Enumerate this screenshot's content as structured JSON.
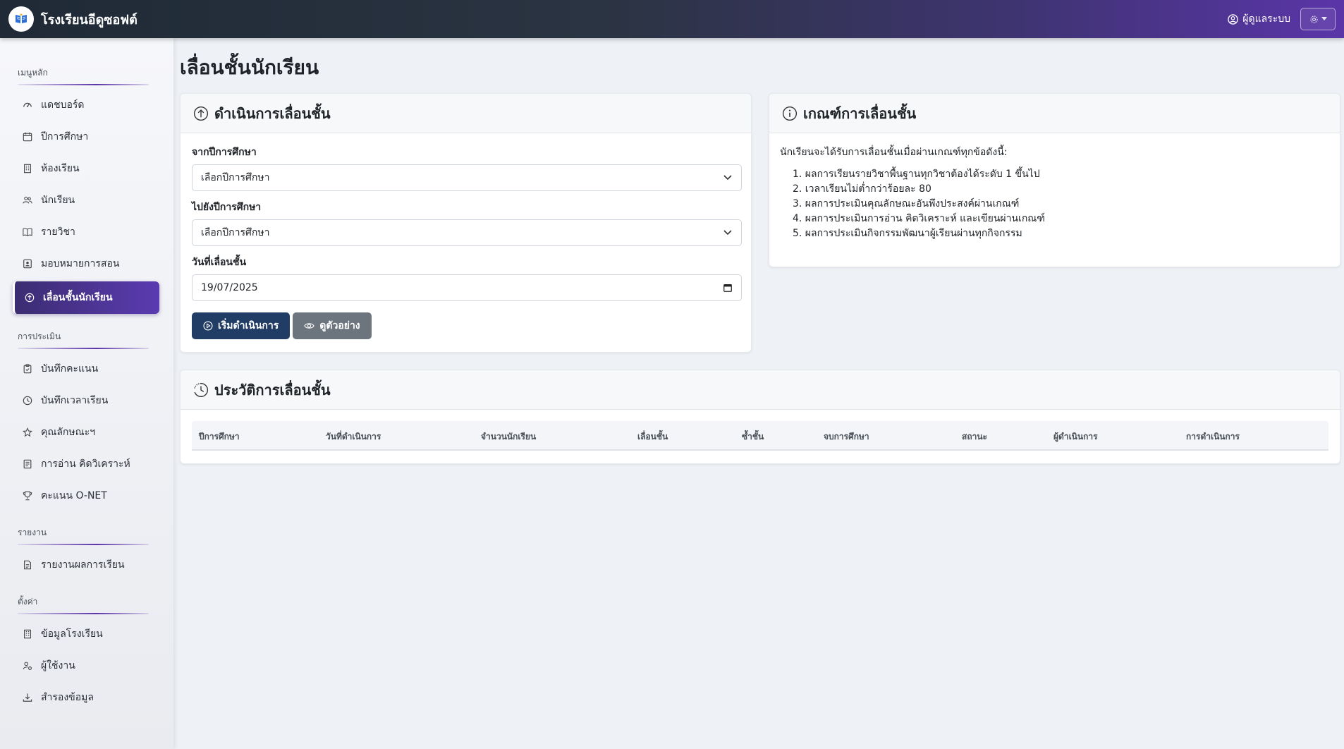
{
  "app": {
    "brand_title": "โรงเรียนอีดูซอฟต์",
    "user_label": "ผู้ดูแลระบบ"
  },
  "sidebar": {
    "sections": [
      {
        "label": "เมนูหลัก",
        "items": [
          {
            "label": "แดชบอร์ด",
            "icon": "speedometer-icon"
          },
          {
            "label": "ปีการศึกษา",
            "icon": "calendar-icon"
          },
          {
            "label": "ห้องเรียน",
            "icon": "building-icon"
          },
          {
            "label": "นักเรียน",
            "icon": "people-icon"
          },
          {
            "label": "รายวิชา",
            "icon": "book-icon"
          },
          {
            "label": "มอบหมายการสอน",
            "icon": "person-badge-icon"
          },
          {
            "label": "เลื่อนชั้นนักเรียน",
            "icon": "arrow-up-circle-icon",
            "active": true
          }
        ]
      },
      {
        "label": "การประเมิน",
        "items": [
          {
            "label": "บันทึกคะแนน",
            "icon": "clipboard-icon"
          },
          {
            "label": "บันทึกเวลาเรียน",
            "icon": "clock-icon"
          },
          {
            "label": "คุณลักษณะฯ",
            "icon": "star-icon"
          },
          {
            "label": "การอ่าน คิดวิเคราะห์",
            "icon": "journal-icon"
          },
          {
            "label": "คะแนน O-NET",
            "icon": "trophy-icon"
          }
        ]
      },
      {
        "label": "รายงาน",
        "items": [
          {
            "label": "รายงานผลการเรียน",
            "icon": "file-text-icon"
          }
        ]
      },
      {
        "label": "ตั้งค่า",
        "items": [
          {
            "label": "ข้อมูลโรงเรียน",
            "icon": "building-icon"
          },
          {
            "label": "ผู้ใช้งาน",
            "icon": "person-gear-icon"
          },
          {
            "label": "สำรองข้อมูล",
            "icon": "download-icon"
          }
        ]
      }
    ]
  },
  "page": {
    "title": "เลื่อนชั้นนักเรียน"
  },
  "promote_card": {
    "title": "ดำเนินการเลื่อนชั้น",
    "from_label": "จากปีการศึกษา",
    "from_value": "เลือกปีการศึกษา",
    "to_label": "ไปยังปีการศึกษา",
    "to_value": "เลือกปีการศึกษา",
    "date_label": "วันที่เลื่อนชั้น",
    "date_value": "19/07/2025",
    "start_button": "เริ่มดำเนินการ",
    "preview_button": "ดูตัวอย่าง"
  },
  "criteria_card": {
    "title": "เกณฑ์การเลื่อนชั้น",
    "intro": "นักเรียนจะได้รับการเลื่อนชั้นเมื่อผ่านเกณฑ์ทุกข้อดังนี้:",
    "items": [
      "1. ผลการเรียนรายวิชาพื้นฐานทุกวิชาต้องได้ระดับ 1 ขึ้นไป",
      "2. เวลาเรียนไม่ต่ำกว่าร้อยละ 80",
      "3. ผลการประเมินคุณลักษณะอันพึงประสงค์ผ่านเกณฑ์",
      "4. ผลการประเมินการอ่าน คิดวิเคราะห์ และเขียนผ่านเกณฑ์",
      "5. ผลการประเมินกิจกรรมพัฒนาผู้เรียนผ่านทุกกิจกรรม"
    ]
  },
  "history_card": {
    "title": "ประวัติการเลื่อนชั้น",
    "columns": [
      "ปีการศึกษา",
      "วันที่ดำเนินการ",
      "จำนวนนักเรียน",
      "เลื่อนชั้น",
      "ซ้ำชั้น",
      "จบการศึกษา",
      "สถานะ",
      "ผู้ดำเนินการ",
      "การดำเนินการ"
    ]
  },
  "colors": {
    "navbar_start": "#1f2a36",
    "navbar_end": "#5a35a8",
    "active_item": "#4a3494",
    "primary_button": "#213d66",
    "secondary_button": "#6c757d"
  }
}
